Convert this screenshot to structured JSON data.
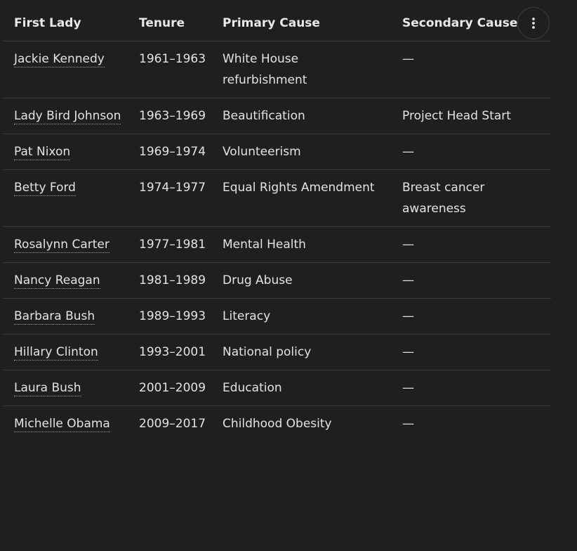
{
  "table": {
    "headers": [
      "First Lady",
      "Tenure",
      "Primary Cause",
      "Secondary Cause"
    ],
    "rows": [
      {
        "name": "Jackie Kennedy",
        "tenure": "1961–1963",
        "primary": "White House refurbishment",
        "secondary": "—"
      },
      {
        "name": "Lady Bird Johnson",
        "tenure": "1963–1969",
        "primary": "Beautification",
        "secondary": "Project Head Start"
      },
      {
        "name": "Pat Nixon",
        "tenure": "1969–1974",
        "primary": "Volunteerism",
        "secondary": "—"
      },
      {
        "name": "Betty Ford",
        "tenure": "1974–1977",
        "primary": "Equal Rights Amendment",
        "secondary": "Breast cancer awareness"
      },
      {
        "name": "Rosalynn Carter",
        "tenure": "1977–1981",
        "primary": "Mental Health",
        "secondary": "—"
      },
      {
        "name": "Nancy Reagan",
        "tenure": "1981–1989",
        "primary": "Drug Abuse",
        "secondary": "—"
      },
      {
        "name": "Barbara Bush",
        "tenure": "1989–1993",
        "primary": "Literacy",
        "secondary": "—"
      },
      {
        "name": "Hillary Clinton",
        "tenure": "1993–2001",
        "primary": "National policy",
        "secondary": "—"
      },
      {
        "name": "Laura Bush",
        "tenure": "2001–2009",
        "primary": "Education",
        "secondary": "—"
      },
      {
        "name": "Michelle Obama",
        "tenure": "2009–2017",
        "primary": "Childhood Obesity",
        "secondary": "—"
      }
    ]
  },
  "menu_button": {
    "icon": "more-vertical-icon"
  },
  "colors": {
    "background": "#1f1f1f",
    "text": "#e3e3e3",
    "divider": "#3c3c3c"
  }
}
